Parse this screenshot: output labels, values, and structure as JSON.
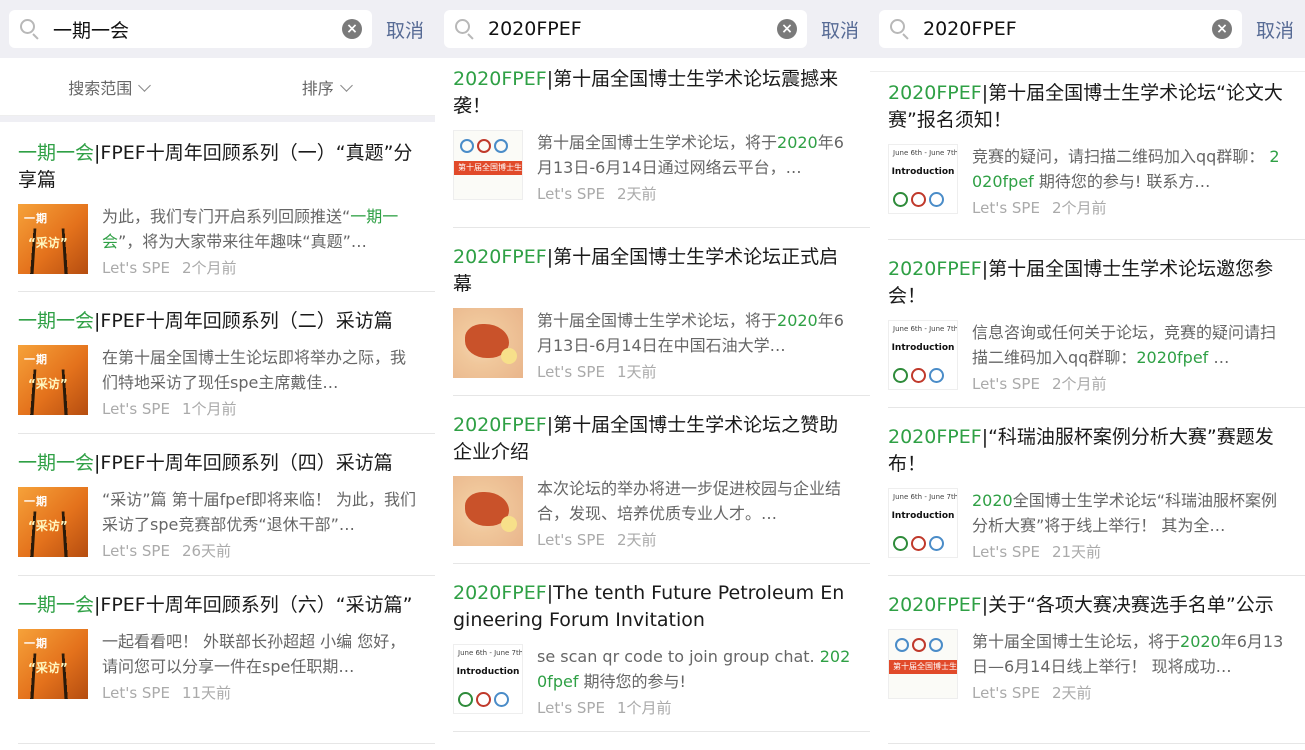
{
  "panels": [
    {
      "query": "一期一会",
      "cancel": "取消",
      "filters": [
        "搜索范围",
        "排序"
      ],
      "items": [
        {
          "title_hl": "一期一会",
          "title_rest": "|FPEF十周年回顾系列（一）“真题”分享篇",
          "desc_pre": "为此，我们专门开启系列回顾推送“",
          "desc_hl": "一期一会",
          "desc_post": "”，将为大家带来往年趣味“真题”…",
          "source": "Let's SPE",
          "time": "2个月前",
          "thumb": "orange"
        },
        {
          "title_hl": "一期一会",
          "title_rest": "|FPEF十周年回顾系列（二）采访篇",
          "desc_pre": "在第十届全国博士生论坛即将举办之际，我们特地采访了现任spe主席戴佳…",
          "desc_hl": "",
          "desc_post": "",
          "source": "Let's SPE",
          "time": "1个月前",
          "thumb": "orange"
        },
        {
          "title_hl": "一期一会",
          "title_rest": "|FPEF十周年回顾系列（四）采访篇",
          "desc_pre": "“采访”篇 第十届fpef即将来临！ 为此，我们采访了spe竞赛部优秀“退休干部”…",
          "desc_hl": "",
          "desc_post": "",
          "source": "Let's SPE",
          "time": "26天前",
          "thumb": "orange"
        },
        {
          "title_hl": "一期一会",
          "title_rest": "|FPEF十周年回顾系列（六）“采访篇”",
          "desc_pre": "一起看看吧！ 外联部长孙超超 小编 您好，请问您可以分享一件在spe任职期…",
          "desc_hl": "",
          "desc_post": "",
          "source": "Let's SPE",
          "time": "11天前",
          "thumb": "orange"
        }
      ]
    },
    {
      "query": "2020FPEF",
      "cancel": "取消",
      "items": [
        {
          "title_hl": "2020FPEF",
          "title_rest": "|第十届全国博士生学术论坛震撼来袭！",
          "desc_pre": "第十届全国博士生学术论坛，将于",
          "desc_hl": "2020",
          "desc_post": "年6月13日-6月14日通过网络云平台，…",
          "source": "Let's SPE",
          "time": "2天前",
          "thumb": "white"
        },
        {
          "title_hl": "2020FPEF",
          "title_rest": "|第十届全国博士生学术论坛正式启幕",
          "desc_pre": "第十届全国博士生学术论坛，将于",
          "desc_hl": "2020",
          "desc_post": "年6月13日-6月14日在中国石油大学…",
          "source": "Let's SPE",
          "time": "1天前",
          "thumb": "map"
        },
        {
          "title_hl": "2020FPEF",
          "title_rest": "|第十届全国博士生学术论坛之赞助企业介绍",
          "desc_pre": "本次论坛的举办将进一步促进校园与企业结合，发现、培养优质专业人才。…",
          "desc_hl": "",
          "desc_post": "",
          "source": "Let's SPE",
          "time": "2天前",
          "thumb": "map"
        },
        {
          "title_hl": "2020FPEF",
          "title_rest": "|The tenth Future Petroleum Engineering Forum Invitation",
          "desc_pre": "se scan qr code to join group chat. ",
          "desc_hl": "2020fpef",
          "desc_post": " 期待您的参与!",
          "source": "Let's SPE",
          "time": "1个月前",
          "thumb": "intro"
        }
      ]
    },
    {
      "query": "2020FPEF",
      "cancel": "取消",
      "items": [
        {
          "title_hl": "2020FPEF",
          "title_rest": "|第十届全国博士生学术论坛“论文大赛”报名须知！",
          "desc_pre": "竞赛的疑问，请扫描二维码加入qq群聊： ",
          "desc_hl": "2020fpef",
          "desc_post": " 期待您的参与! 联系方…",
          "source": "Let's SPE",
          "time": "2个月前",
          "thumb": "intro"
        },
        {
          "title_hl": "2020FPEF",
          "title_rest": "|第十届全国博士生学术论坛邀您参会！",
          "desc_pre": "信息咨询或任何关于论坛，竞赛的疑问请扫描二维码加入qq群聊：",
          "desc_hl": "2020fpef",
          "desc_post": " …",
          "source": "Let's SPE",
          "time": "2个月前",
          "thumb": "intro"
        },
        {
          "title_hl": "2020FPEF",
          "title_rest": "|“科瑞油服杯案例分析大赛”赛题发布！",
          "desc_pre": "",
          "desc_hl": "2020",
          "desc_post": "全国博士生学术论坛“科瑞油服杯案例分析大赛”将于线上举行！ 其为全…",
          "source": "Let's SPE",
          "time": "21天前",
          "thumb": "intro"
        },
        {
          "title_hl": "2020FPEF",
          "title_rest": "|关于“各项大赛决赛选手名单”公示",
          "desc_pre": "第十届全国博士生论坛，将于",
          "desc_hl": "2020",
          "desc_post": "年6月13日—6月14日线上举行！ 现将成功…",
          "source": "Let's SPE",
          "time": "2天前",
          "thumb": "white"
        }
      ]
    }
  ],
  "thumb_text": {
    "orange_a": "一期",
    "orange_b": "“采访”",
    "white_bar": "第十届全国博士生",
    "intro_top": "June 6th - June 7th, 2020",
    "intro_main": "Introduction"
  },
  "colors": {
    "highlight": "#2fa045",
    "cancel": "#576b95",
    "search_bg": "#efeff4"
  }
}
